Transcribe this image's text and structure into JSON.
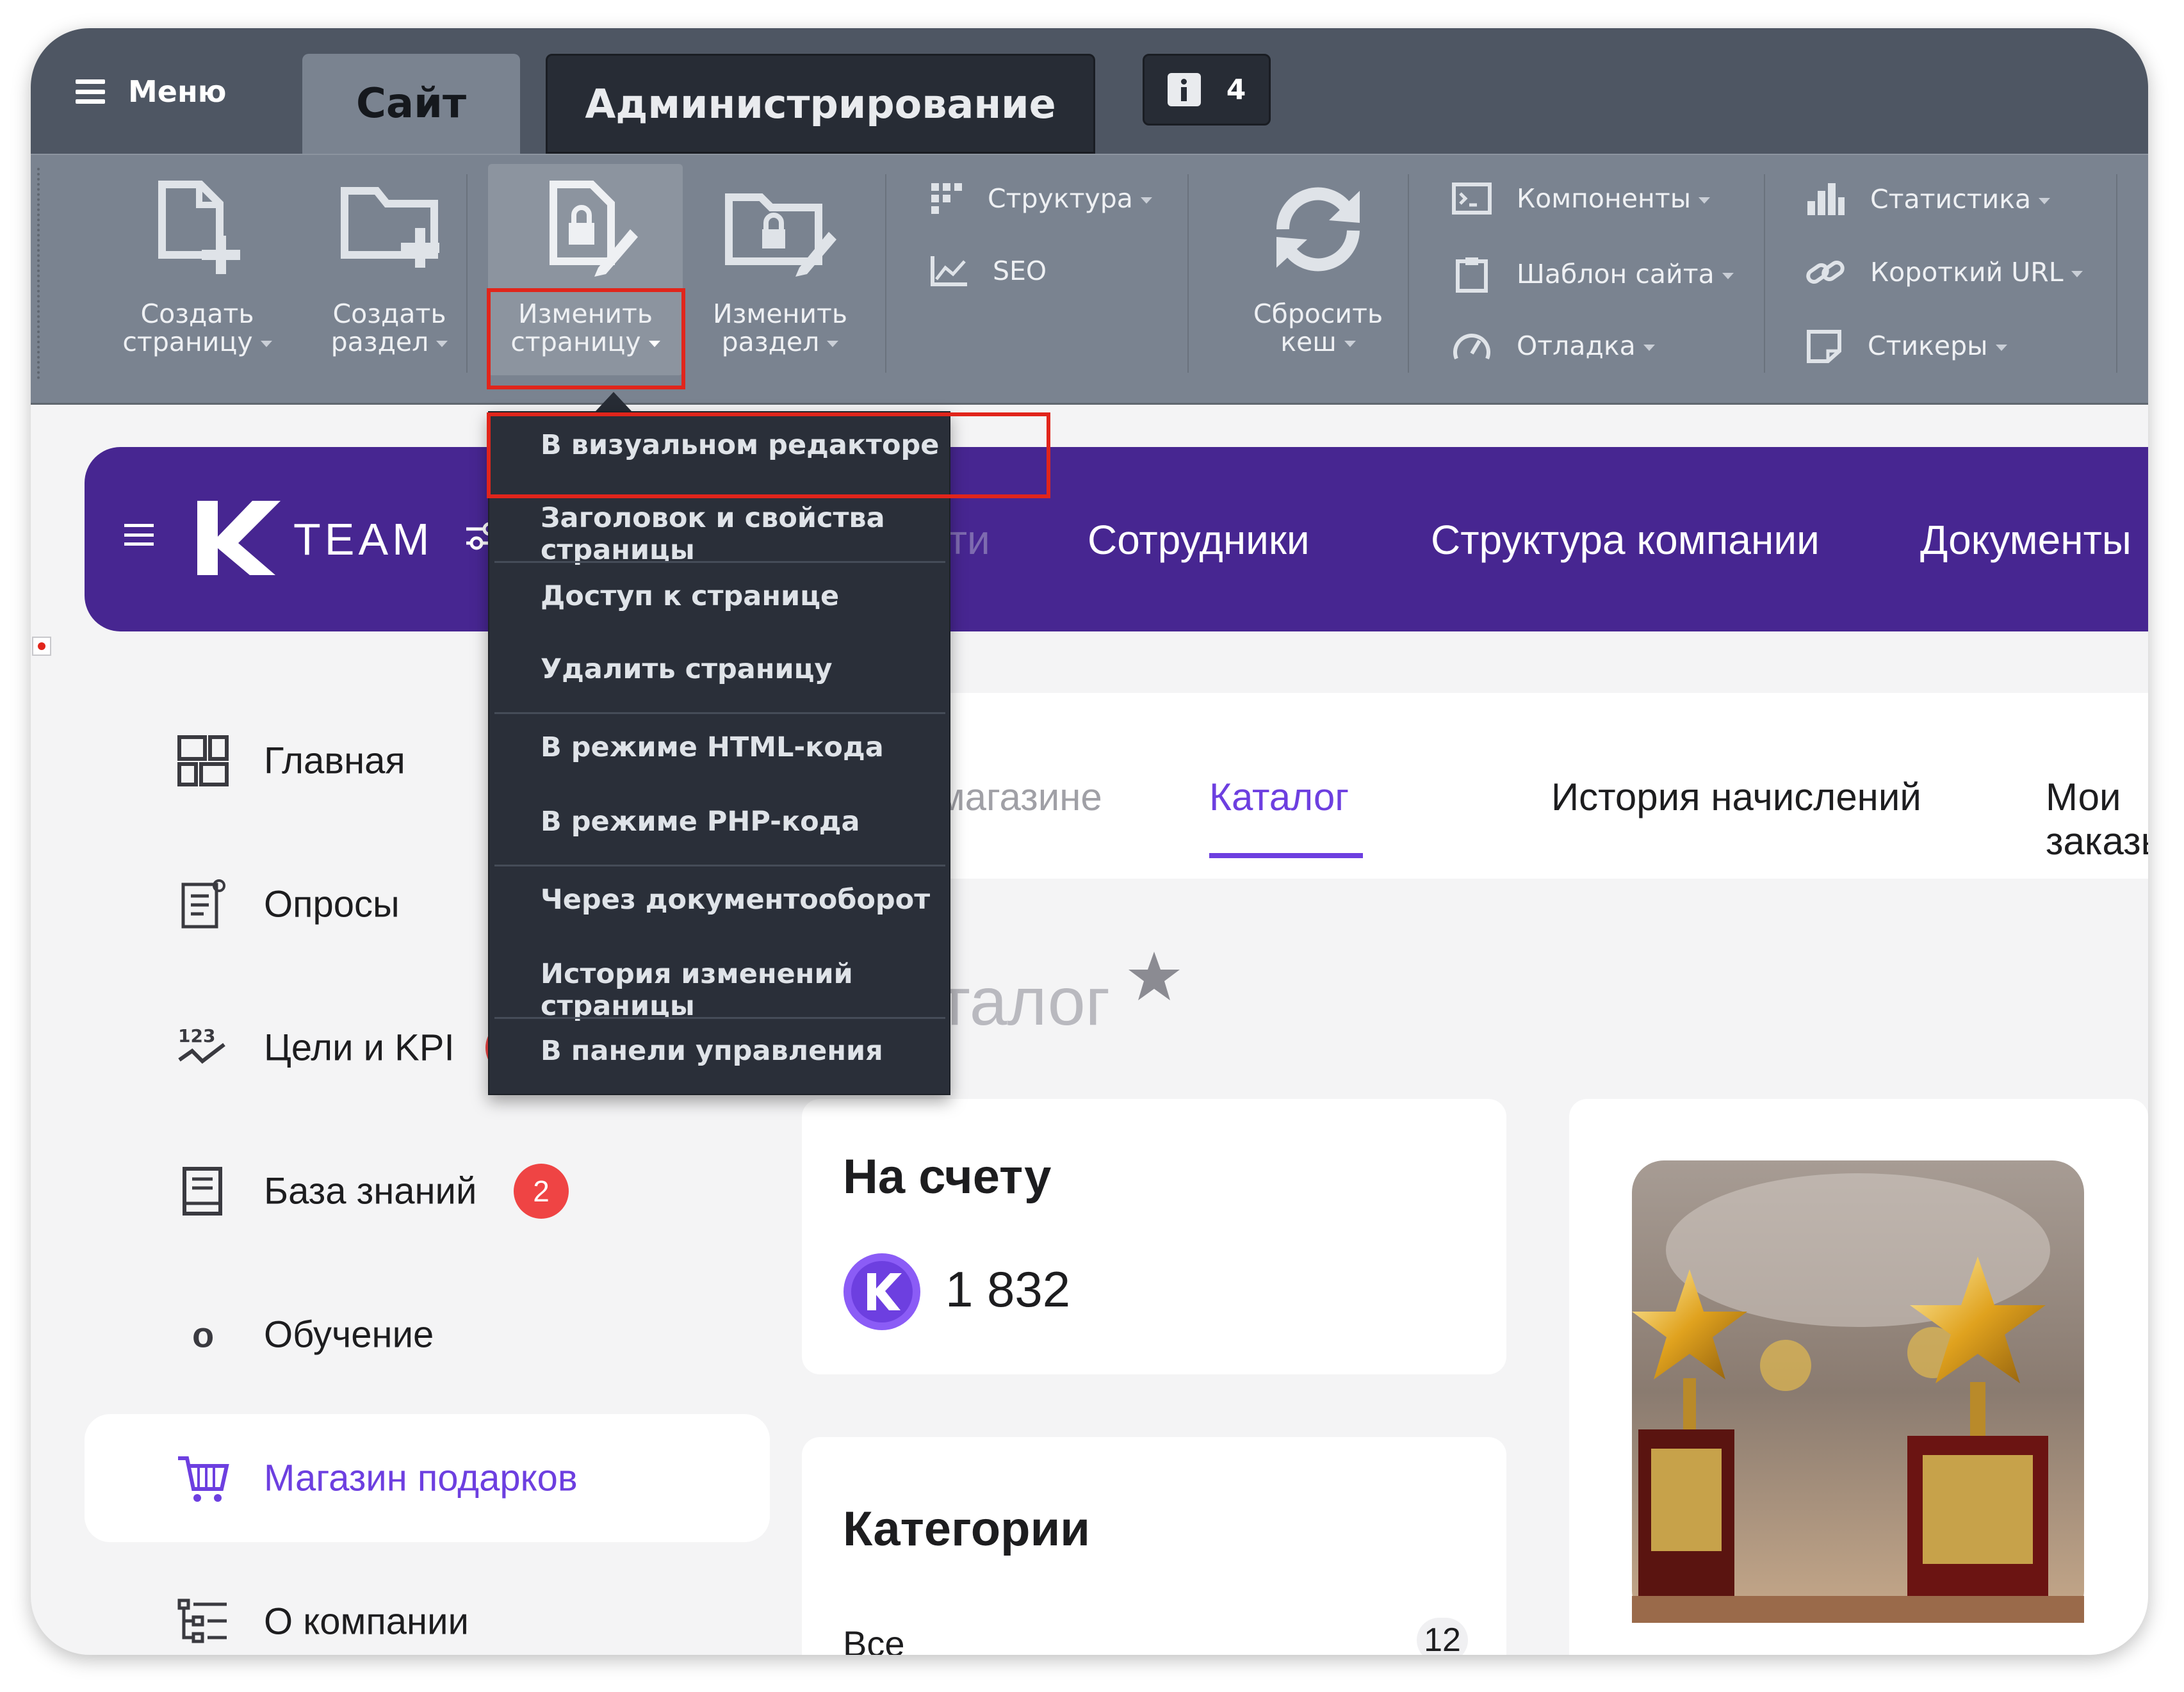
{
  "topbar": {
    "menu_label": "Меню",
    "tab_site": "Сайт",
    "tab_admin": "Администрирование",
    "notif_count": "4"
  },
  "toolbar": {
    "create_page": [
      "Создать",
      "страницу"
    ],
    "create_section": [
      "Создать",
      "раздел"
    ],
    "edit_page": [
      "Изменить",
      "страницу"
    ],
    "edit_section": [
      "Изменить",
      "раздел"
    ],
    "structure": "Структура",
    "seo": "SEO",
    "reset_cache": [
      "Сбросить",
      "кеш"
    ],
    "components": "Компоненты",
    "site_template": "Шаблон сайта",
    "debug": "Отладка",
    "statistics": "Статистика",
    "short_url": "Короткий URL",
    "stickers": "Стикеры"
  },
  "dropdown": {
    "items": [
      "В визуальном редакторе",
      "Заголовок и свойства страницы",
      "Доступ к странице",
      "Удалить страницу",
      "В режиме HTML-кода",
      "В режиме PHP-кода",
      "Через документооборот",
      "История изменений страницы",
      "В панели управления"
    ]
  },
  "header": {
    "logo_text": "TEAM",
    "nav": [
      "Новости",
      "Сотрудники",
      "Структура компании",
      "Документы"
    ]
  },
  "sidebar": {
    "items": [
      {
        "label": "Главная",
        "icon": "grid-icon"
      },
      {
        "label": "Опросы",
        "icon": "survey-icon"
      },
      {
        "label": "Цели и KPI",
        "icon": "kpi-icon",
        "badge": "1"
      },
      {
        "label": "База знаний",
        "icon": "book-icon",
        "badge": "2"
      },
      {
        "label": "Обучение",
        "icon": "o-icon"
      },
      {
        "label": "Магазин подарков",
        "icon": "cart-icon",
        "selected": true
      },
      {
        "label": "О компании",
        "icon": "tree-icon"
      }
    ],
    "learning_glyph": "o"
  },
  "subnav": {
    "tabs": [
      "О магазине",
      "Каталог",
      "История начислений",
      "Мои заказы"
    ],
    "active": "Каталог"
  },
  "page": {
    "title": "Каталог"
  },
  "balance": {
    "title": "На счету",
    "amount": "1 832"
  },
  "categories": {
    "title": "Категории",
    "all_label": "Все",
    "all_count": "12"
  },
  "colors": {
    "accent": "#6d3fe0",
    "header_purple": "#472691",
    "toolbar_gray": "#7a8390",
    "topbar_dark": "#4e5663",
    "badge_red": "#ef4444",
    "highlight_red": "#e1251b"
  }
}
